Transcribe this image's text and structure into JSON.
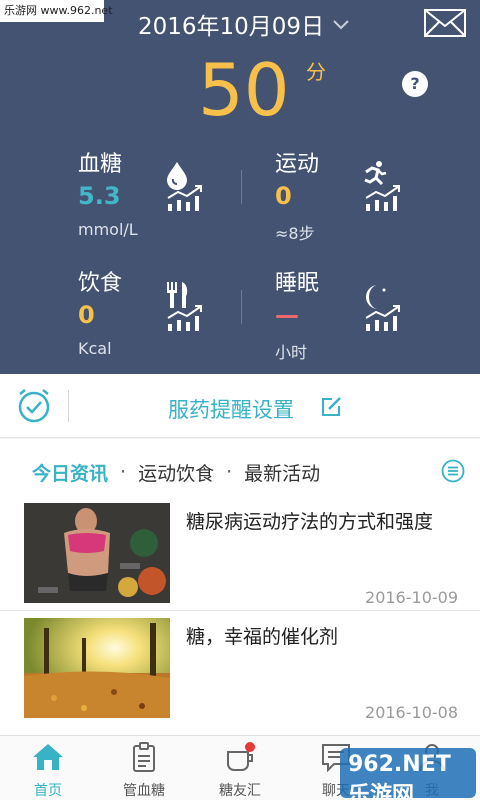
{
  "watermark": "乐游网 www.962.net",
  "header": {
    "date": "2016年10月09日",
    "score": "50",
    "score_unit": "分",
    "help": "?"
  },
  "stats": {
    "blood_sugar": {
      "label": "血糖",
      "value": "5.3",
      "unit": "mmol/L",
      "color": "#43b7c8"
    },
    "exercise": {
      "label": "运动",
      "value": "0",
      "unit": "≈8步",
      "color": "#f7c04a"
    },
    "diet": {
      "label": "饮食",
      "value": "0",
      "unit": "Kcal",
      "color": "#f7c04a"
    },
    "sleep": {
      "label": "睡眠",
      "value": "—",
      "unit": "小时",
      "color": "#ea6a6a"
    }
  },
  "reminder": {
    "label": "服药提醒设置"
  },
  "news": {
    "tabs": [
      {
        "label": "今日资讯"
      },
      {
        "label": "运动饮食"
      },
      {
        "label": "最新活动"
      }
    ],
    "separator": "·",
    "articles": [
      {
        "title": "糖尿病运动疗法的方式和强度",
        "date": "2016-10-09"
      },
      {
        "title": "糖，幸福的催化剂",
        "date": "2016-10-08"
      }
    ]
  },
  "tabbar": {
    "items": [
      {
        "label": "首页"
      },
      {
        "label": "管血糖"
      },
      {
        "label": "糖友汇"
      },
      {
        "label": "聊天"
      },
      {
        "label": "我"
      }
    ]
  },
  "badge_watermark": "962.NET 乐游网",
  "colors": {
    "header_bg": "#445372",
    "accent": "#38b2c6",
    "score": "#f7c04a"
  }
}
